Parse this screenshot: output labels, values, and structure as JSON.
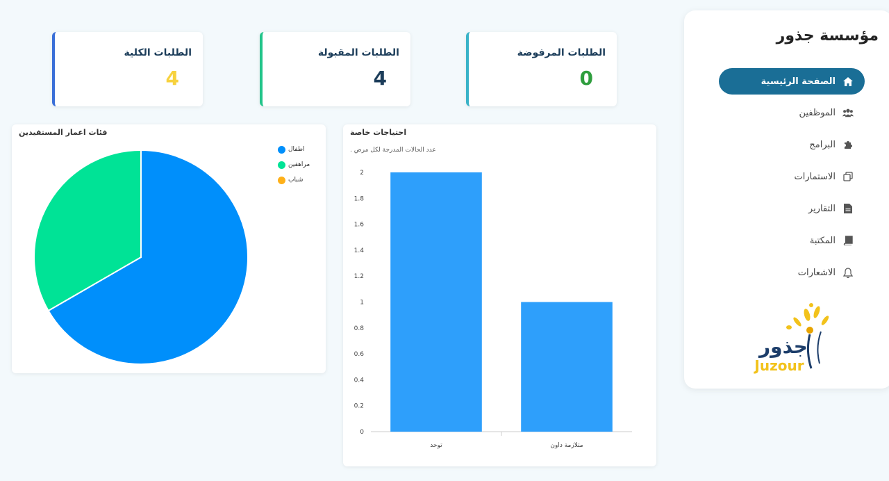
{
  "sidebar": {
    "brand": "مؤسسة جذور",
    "items": [
      {
        "label": "الصفحة الرئيسية",
        "icon": "home-icon",
        "active": true
      },
      {
        "label": "الموظفين",
        "icon": "users-icon"
      },
      {
        "label": "البرامج",
        "icon": "puzzle-icon"
      },
      {
        "label": "الاستمارات",
        "icon": "copy-icon"
      },
      {
        "label": "التقارير",
        "icon": "file-icon"
      },
      {
        "label": "المكتبة",
        "icon": "book-icon"
      },
      {
        "label": "الاشعارات",
        "icon": "bell-icon"
      }
    ],
    "logo": {
      "arabic": "جذور",
      "latin": "Juzour"
    }
  },
  "stats": {
    "total": {
      "label": "الطلبات الكلية",
      "value": "4",
      "color": "#f7d23e",
      "border": "#3a6fd8"
    },
    "accepted": {
      "label": "الطلبات المقبولة",
      "value": "4",
      "color": "#1c3d5a",
      "border": "#22c48a"
    },
    "rejected": {
      "label": "الطلبات المرفوضة",
      "value": "0",
      "color": "#2f9e3e",
      "border": "#39b3c8"
    }
  },
  "pie": {
    "title": "فئات اعمار المستفيدين",
    "legend": [
      "اطفال",
      "مراهقين",
      "شباب"
    ]
  },
  "bar": {
    "title": "احتياجات خاصة",
    "subtitle": "عدد الحالات المدرجة لكل مرض ."
  },
  "chart_data": [
    {
      "type": "pie",
      "title": "فئات اعمار المستفيدين",
      "categories": [
        "اطفال",
        "مراهقين",
        "شباب"
      ],
      "values": [
        2,
        1,
        0
      ],
      "colors": [
        "#008ffb",
        "#00e396",
        "#feb019"
      ],
      "legend": "top-right"
    },
    {
      "type": "bar",
      "title": "احتياجات خاصة",
      "subtitle": "عدد الحالات المدرجة لكل مرض .",
      "categories": [
        "توحد",
        "متلازمة داون"
      ],
      "values": [
        2,
        1
      ],
      "ylim": [
        0,
        2
      ],
      "yticks": [
        "0",
        "0.2",
        "0.4",
        "0.6",
        "0.8",
        "1",
        "1.2",
        "1.4",
        "1.6",
        "1.8",
        "2"
      ],
      "color": "#2e9ffb",
      "grid": false
    }
  ]
}
